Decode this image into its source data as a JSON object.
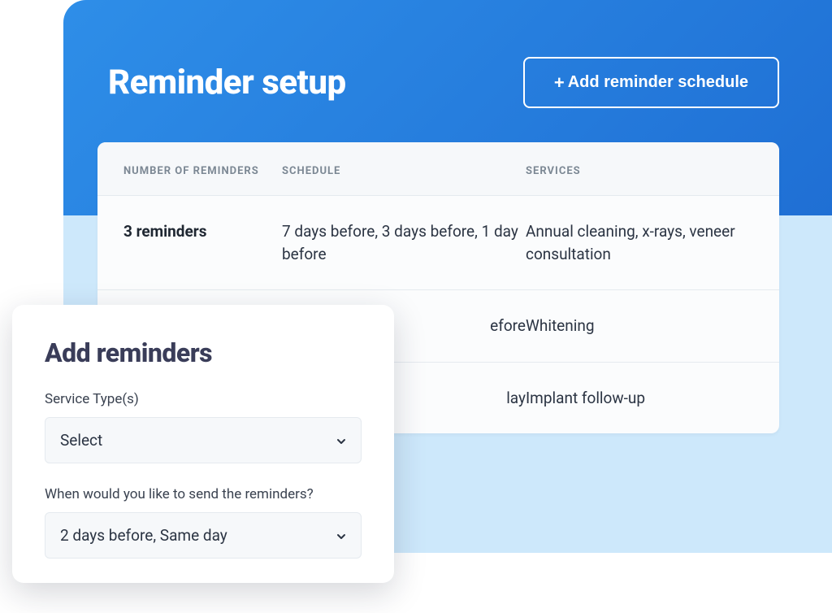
{
  "header": {
    "title": "Reminder setup",
    "add_button_label": "Add reminder schedule"
  },
  "table": {
    "columns": {
      "reminders": "NUMBER OF REMINDERS",
      "schedule": "SCHEDULE",
      "services": "SERVICES"
    },
    "rows": [
      {
        "reminders": "3 reminders",
        "schedule": "7 days before, 3 days before, 1 day before",
        "services": "Annual cleaning, x-rays, veneer consultation"
      },
      {
        "reminders": "",
        "schedule": "efore",
        "services": "Whitening"
      },
      {
        "reminders": "",
        "schedule": "lay",
        "services": "Implant follow-up"
      }
    ]
  },
  "modal": {
    "title": "Add reminders",
    "field_service_label": "Service Type(s)",
    "service_select_value": "Select",
    "field_schedule_label": "When would you like to send the reminders?",
    "schedule_select_value": "2 days before, Same day"
  }
}
